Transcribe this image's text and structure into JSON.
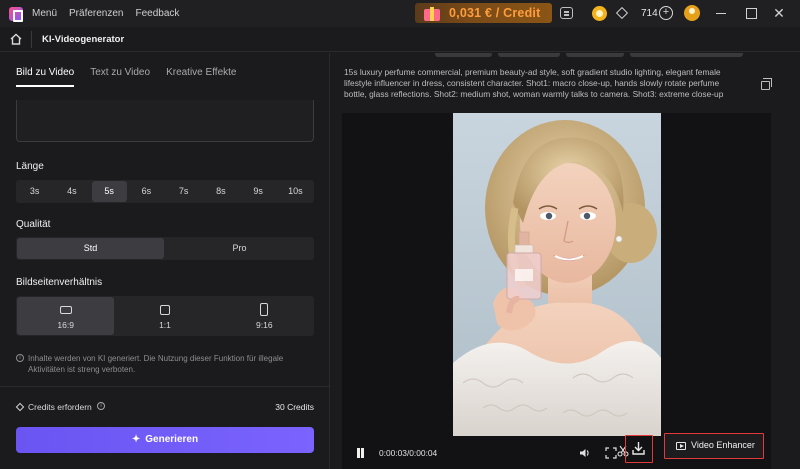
{
  "titlebar": {
    "menu": "Menü",
    "preferences": "Präferenzen",
    "feedback": "Feedback",
    "credit_offer": "0,031 € / Credit",
    "balance": "714"
  },
  "header": {
    "title": "KI-Videogenerator"
  },
  "left": {
    "tabs": [
      {
        "label": "Bild zu Video",
        "active": true
      },
      {
        "label": "Text zu Video",
        "active": false
      },
      {
        "label": "Kreative Effekte",
        "active": false
      }
    ],
    "length": {
      "label": "Länge",
      "options": [
        "3s",
        "4s",
        "5s",
        "6s",
        "7s",
        "8s",
        "9s",
        "10s"
      ],
      "selected": "5s"
    },
    "quality": {
      "label": "Qualität",
      "options": [
        "Std",
        "Pro"
      ],
      "selected": "Std"
    },
    "aspect": {
      "label": "Bildseitenverhältnis",
      "options": [
        "16:9",
        "1:1",
        "9:16"
      ],
      "selected": "16:9"
    },
    "notice": "Inhalte werden von KI generiert. Die Nutzung dieser Funktion für illegale Aktivitäten ist streng verboten.",
    "credits_label": "Credits erfordern",
    "credits_value": "30 Credits",
    "generate_label": "Generieren"
  },
  "right": {
    "prompt": "15s luxury perfume commercial, premium beauty-ad style, soft gradient studio lighting, elegant female lifestyle influencer in dress, consistent character. Shot1: macro close-up, hands slowly rotate perfume bottle, glass reflections. Shot2: medium shot, woman warmly talks to camera. Shot3: extreme close-up side angle, woman gently sprays perfume onto neck/wrist, mist moves toward skin, realistic atomizer",
    "player": {
      "timecode": "0:00:03/0:00:04"
    },
    "video_enhancer_label": "Video Enhancer"
  },
  "colors": {
    "accent": "#7a63ff",
    "credit_text": "#ff9d3d",
    "highlight_border": "#e03a3a"
  }
}
